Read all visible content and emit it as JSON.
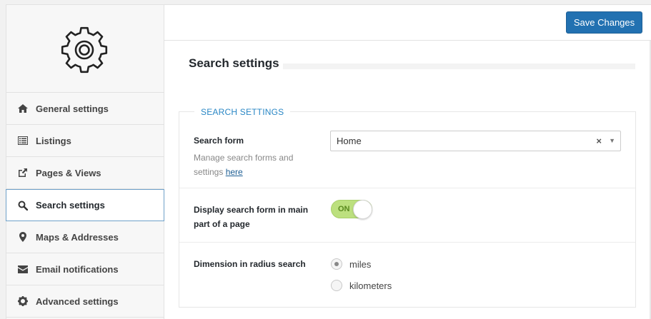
{
  "header": {
    "save_label": "Save Changes"
  },
  "sidebar": {
    "logo_icon": "gear-icon",
    "items": [
      {
        "label": "General settings",
        "icon": "home-icon",
        "active": false
      },
      {
        "label": "Listings",
        "icon": "list-icon",
        "active": false
      },
      {
        "label": "Pages & Views",
        "icon": "external-link-icon",
        "active": false
      },
      {
        "label": "Search settings",
        "icon": "search-icon",
        "active": true
      },
      {
        "label": "Maps & Addresses",
        "icon": "map-marker-icon",
        "active": false
      },
      {
        "label": "Email notifications",
        "icon": "envelope-icon",
        "active": false
      },
      {
        "label": "Advanced settings",
        "icon": "cog-icon",
        "active": false
      }
    ]
  },
  "main": {
    "page_title": "Search settings",
    "section": {
      "legend": "SEARCH SETTINGS",
      "search_form": {
        "label": "Search form",
        "description": "Manage search forms and settings",
        "link_text": "here",
        "selected_value": "Home",
        "clear_symbol": "×",
        "arrow_symbol": "▼"
      },
      "display_search_form": {
        "label": "Display search form in main part of a page",
        "toggle_label": "ON"
      },
      "radius_dimension": {
        "label": "Dimension in radius search",
        "options": [
          "miles",
          "kilometers"
        ],
        "selected": "miles"
      }
    }
  },
  "colors": {
    "accent": "#2271b1",
    "legend": "#2a87c5",
    "toggle_on": "#bce07e",
    "active_border": "#6fa0c9"
  }
}
